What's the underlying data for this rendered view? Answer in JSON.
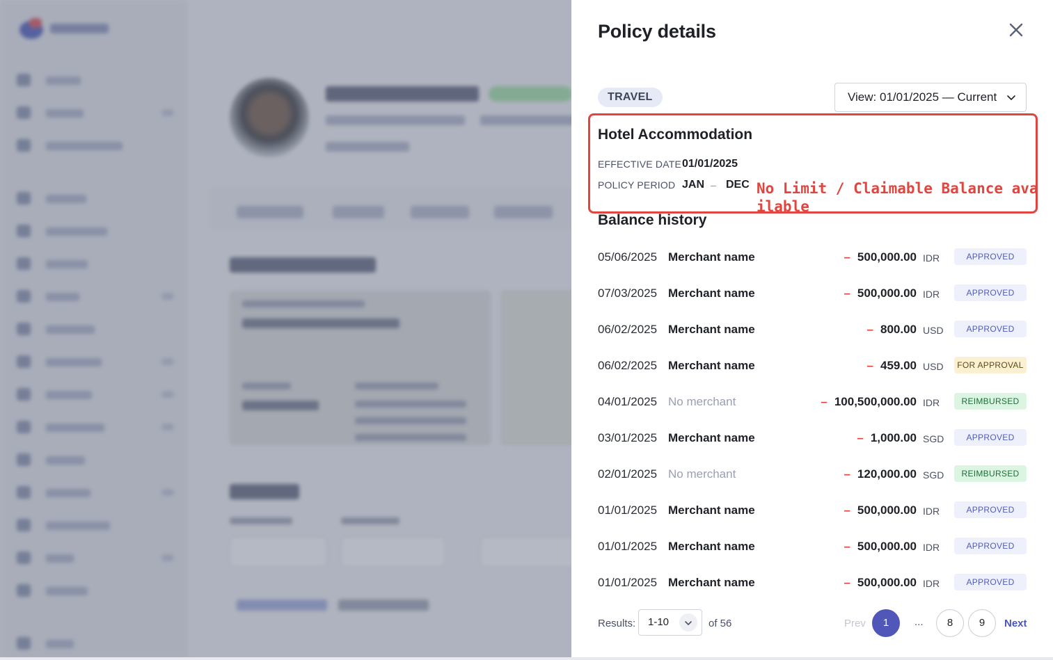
{
  "panel": {
    "title": "Policy details",
    "category_tag": "TRAVEL",
    "view_select": "View: 01/01/2025 — Current",
    "policy_name": "Hotel Accommodation",
    "effective_date_label": "EFFECTIVE DATE",
    "effective_date": "01/01/2025",
    "policy_period_label": "POLICY PERIOD",
    "period_start": "JAN",
    "period_dash": "–",
    "period_end": "DEC",
    "annotation": "No Limit / Claimable Balance available",
    "balance_history_title": "Balance history"
  },
  "balance_history": [
    {
      "date": "05/06/2025",
      "merchant": "Merchant name",
      "amount": "500,000.00",
      "currency": "IDR",
      "status": "APPROVED"
    },
    {
      "date": "07/03/2025",
      "merchant": "Merchant name",
      "amount": "500,000.00",
      "currency": "IDR",
      "status": "APPROVED"
    },
    {
      "date": "06/02/2025",
      "merchant": "Merchant name",
      "amount": "800.00",
      "currency": "USD",
      "status": "APPROVED"
    },
    {
      "date": "06/02/2025",
      "merchant": "Merchant name",
      "amount": "459.00",
      "currency": "USD",
      "status": "FOR APPROVAL"
    },
    {
      "date": "04/01/2025",
      "merchant": "No merchant",
      "amount": "100,500,000.00",
      "currency": "IDR",
      "status": "REIMBURSED"
    },
    {
      "date": "03/01/2025",
      "merchant": "Merchant name",
      "amount": "1,000.00",
      "currency": "SGD",
      "status": "APPROVED"
    },
    {
      "date": "02/01/2025",
      "merchant": "No merchant",
      "amount": "120,000.00",
      "currency": "SGD",
      "status": "REIMBURSED"
    },
    {
      "date": "01/01/2025",
      "merchant": "Merchant name",
      "amount": "500,000.00",
      "currency": "IDR",
      "status": "APPROVED"
    },
    {
      "date": "01/01/2025",
      "merchant": "Merchant name",
      "amount": "500,000.00",
      "currency": "IDR",
      "status": "APPROVED"
    },
    {
      "date": "01/01/2025",
      "merchant": "Merchant name",
      "amount": "500,000.00",
      "currency": "IDR",
      "status": "APPROVED"
    }
  ],
  "amount_sign": "–",
  "pagination": {
    "results_label": "Results:",
    "page_size": "1-10",
    "of_total": "of 56",
    "prev": "Prev",
    "pages": [
      "1",
      "8",
      "9"
    ],
    "ellipsis": "...",
    "next": "Next"
  },
  "colors": {
    "accent": "#5057b9",
    "annotation_red": "#e0463f",
    "approved_bg": "#eef0fb",
    "for_approval_bg": "#fbf1d2",
    "reimbursed_bg": "#dcf5e3"
  },
  "icons": {
    "close": "close-icon",
    "select_chevron": "chevron-down-icon"
  }
}
